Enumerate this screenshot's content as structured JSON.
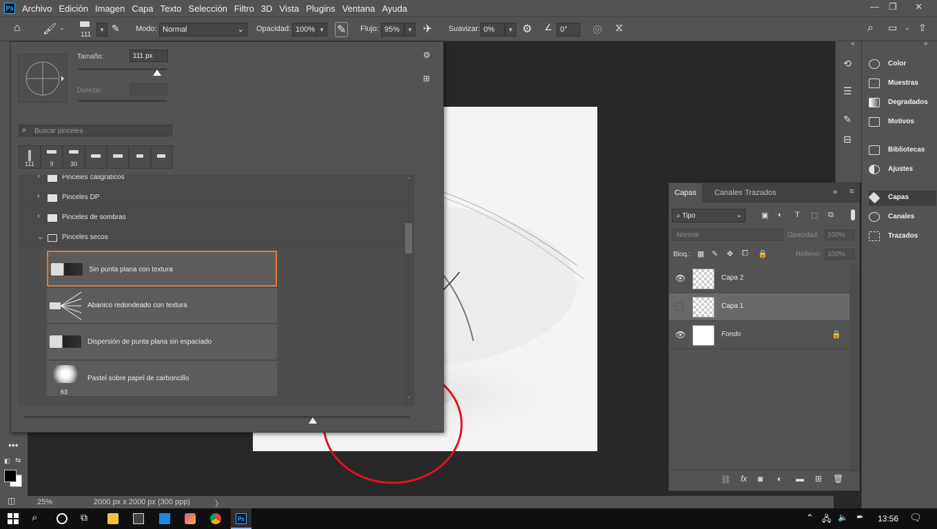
{
  "menu": {
    "items": [
      "Archivo",
      "Edición",
      "Imagen",
      "Capa",
      "Texto",
      "Selección",
      "Filtro",
      "3D",
      "Vista",
      "Plugins",
      "Ventana",
      "Ayuda"
    ]
  },
  "window_controls": {
    "minimize": "—",
    "restore": "❐",
    "close": "✕"
  },
  "options_bar": {
    "brush_size_label": "111",
    "mode_label": "Modo:",
    "mode_value": "Normal",
    "opacity_label": "Opacidad:",
    "opacity_value": "100%",
    "flow_label": "Flujo:",
    "flow_value": "95%",
    "smooth_label": "Suavizar:",
    "smooth_value": "0%",
    "angle_value": "0°"
  },
  "brush_popup": {
    "size_label": "Tamaño:",
    "size_value": "111 px",
    "hardness_label": "Dureza:",
    "search_placeholder": "Buscar pinceles",
    "presets": [
      "111",
      "9",
      "30",
      "",
      "",
      "",
      ""
    ],
    "folders": [
      "Pinceles caligráficos",
      "Pinceles DP",
      "Pinceles de sombras",
      "Pinceles secos"
    ],
    "brushes": [
      {
        "name": "Sin punta plana con textura",
        "selected": true
      },
      {
        "name": "Abanico redondeado con textura",
        "selected": false
      },
      {
        "name": "Dispersión de punta plana sin espaciado",
        "selected": false
      },
      {
        "name": "Pastel sobre papel de carboncillo",
        "number": "63",
        "selected": false
      }
    ],
    "preview_slider_level": 0.75
  },
  "status_bar": {
    "zoom": "25%",
    "doc_info": "2000 px x 2000 px (300 ppp)",
    "arrow": "〉"
  },
  "layers_panel": {
    "tabs": [
      "Capas",
      "Canales",
      "Trazados"
    ],
    "filter_value": "Tipo",
    "blend_mode": "Normal",
    "opacity_label": "Opacidad:",
    "opacity_value": "100%",
    "lock_label": "Bloq.:",
    "fill_label": "Relleno:",
    "fill_value": "100%",
    "layers": [
      {
        "name": "Capa 2",
        "visible": true,
        "active": false
      },
      {
        "name": "Capa 1",
        "visible": false,
        "active": true
      },
      {
        "name": "Fondo",
        "visible": true,
        "active": false,
        "locked": true
      }
    ]
  },
  "right_dock": {
    "items": [
      "Color",
      "Muestras",
      "Degradados",
      "Motivos",
      "Bibliotecas",
      "Ajustes",
      "Capas",
      "Canales",
      "Trazados"
    ]
  },
  "taskbar": {
    "time": "13:56"
  },
  "colors": {
    "ui_bg": "#535353",
    "canvas_bg": "#282828",
    "selection_accent": "#e9792e",
    "annotation_circle": "#e01020"
  }
}
